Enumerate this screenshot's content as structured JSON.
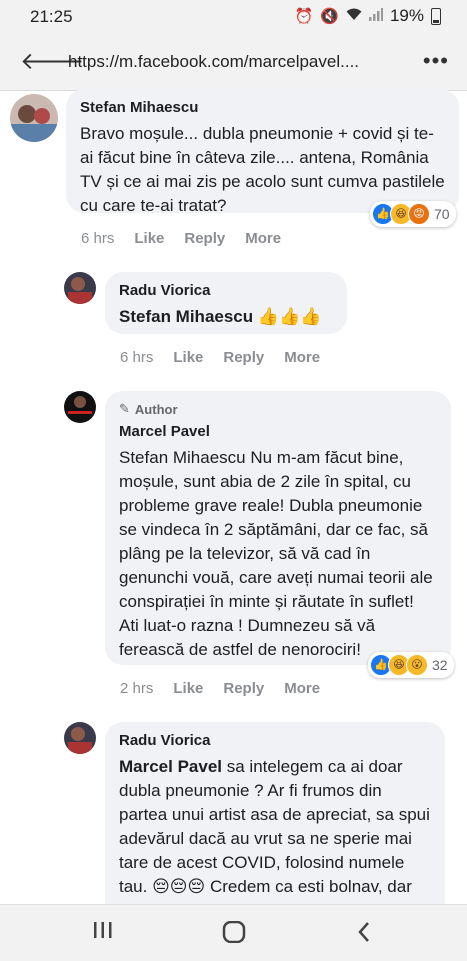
{
  "status_bar": {
    "time": "21:25",
    "battery": "19%"
  },
  "browser": {
    "url": "https://m.facebook.com/marcelpavel...."
  },
  "comments": [
    {
      "author": "Stefan Mihaescu",
      "text": "Bravo moșule... dubla pneumonie + covid și te-ai făcut bine în câteva zile.... antena, România TV și ce ai mai zis pe acolo sunt cumva pastilele cu care te-ai tratat?",
      "time": "6 hrs",
      "like": "Like",
      "reply": "Reply",
      "more": "More",
      "reaction_count": "70"
    },
    {
      "author": "Radu Viorica",
      "mention": "Stefan Mihaescu",
      "emoji": "👍👍👍",
      "time": "6 hrs",
      "like": "Like",
      "reply": "Reply",
      "more": "More"
    },
    {
      "badge": "Author",
      "author": "Marcel Pavel",
      "text": "Stefan Mihaescu Nu m-am făcut bine, moșule, sunt abia de 2 zile în spital, cu probleme grave reale! Dubla pneumonie se vindeca în 2 săptămâni, dar ce fac, să plâng pe la televizor, să vă cad în genunchi vouă, care aveți numai teorii ale conspirației în minte și răutate în suflet! Ati luat-o razna ! Dumnezeu să vă ferească de astfel de nenorociri!",
      "time": "2 hrs",
      "like": "Like",
      "reply": "Reply",
      "more": "More",
      "reaction_count": "32"
    },
    {
      "author": "Radu Viorica",
      "mention": "Marcel Pavel",
      "text": "sa intelegem ca ai doar dubla pneumonie ? Ar fi frumos din partea unui artist asa de apreciat, sa spui adevărul dacă au vrut sa ne sperie mai tare de acest COVID, folosind numele tau. 😔😔😔 Credem ca esti bolnav, dar nu credem"
    }
  ],
  "avatar_text": {
    "marcel": "MARCEL PAVEL"
  },
  "colors": {
    "bubble": "#f0f2f5",
    "like": "#1877f2",
    "meta": "#8a8d91"
  }
}
